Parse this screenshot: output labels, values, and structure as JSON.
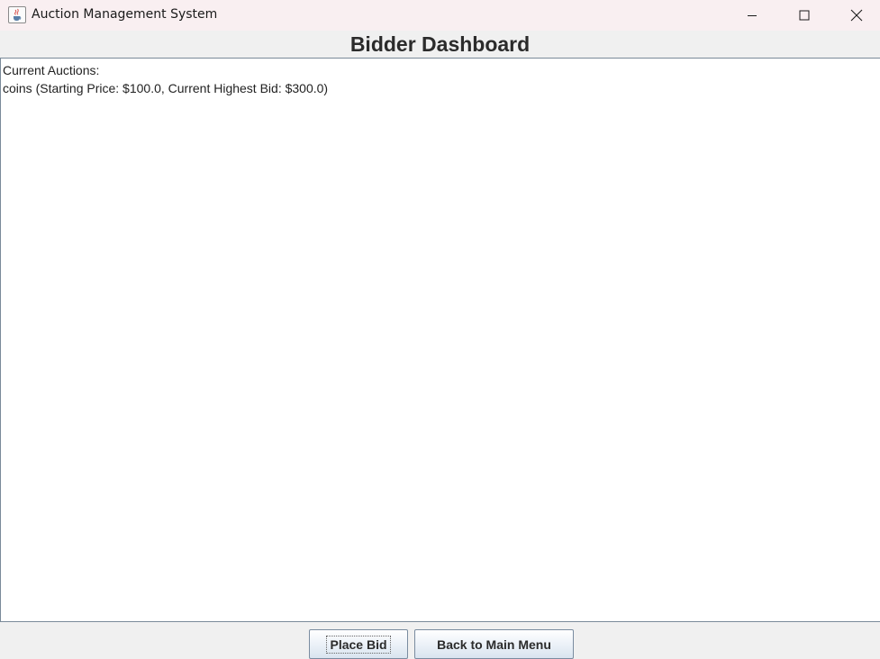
{
  "window": {
    "title": "Auction Management System"
  },
  "header": {
    "title": "Bidder Dashboard"
  },
  "auctions_text": {
    "lines": [
      "Current Auctions:",
      "coins (Starting Price: $100.0, Current Highest Bid: $300.0)"
    ]
  },
  "buttons": {
    "place_bid": "Place Bid",
    "back": "Back to Main Menu"
  },
  "icons": {
    "app": "java-coffee-cup-icon",
    "minimize": "minimize-icon",
    "maximize": "maximize-icon",
    "close": "close-icon"
  }
}
